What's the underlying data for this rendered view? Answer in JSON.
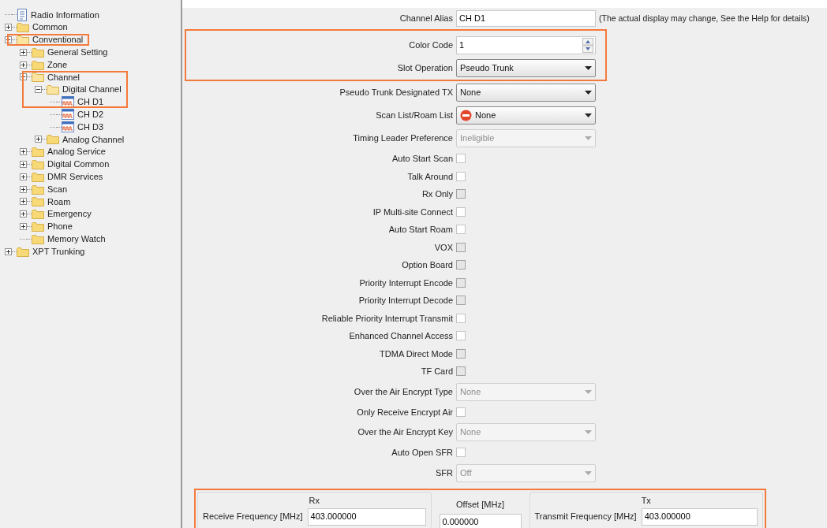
{
  "tree": [
    {
      "label": "Radio Information",
      "kind": "document",
      "highlighted": false
    },
    {
      "label": "Common",
      "kind": "folder",
      "expanded": false,
      "highlighted": false
    },
    {
      "label": "Conventional",
      "kind": "folder",
      "expanded": true,
      "highlighted": true,
      "children": [
        {
          "label": "General Setting",
          "kind": "folder",
          "expanded": false,
          "highlighted": false
        },
        {
          "label": "Zone",
          "kind": "folder",
          "expanded": false,
          "highlighted": false
        },
        {
          "label": "Channel",
          "kind": "folder",
          "expanded": true,
          "highlighted": true,
          "children": [
            {
              "label": "Digital Channel",
              "kind": "folder",
              "expanded": true,
              "highlighted": true,
              "children": [
                {
                  "label": "CH D1",
                  "kind": "channel",
                  "highlighted": true
                },
                {
                  "label": "CH D2",
                  "kind": "channel",
                  "highlighted": false
                },
                {
                  "label": "CH D3",
                  "kind": "channel",
                  "highlighted": false
                }
              ]
            },
            {
              "label": "Analog Channel",
              "kind": "folder",
              "expanded": false,
              "highlighted": false
            }
          ]
        },
        {
          "label": "Analog Service",
          "kind": "folder",
          "expanded": false,
          "highlighted": false
        },
        {
          "label": "Digital Common",
          "kind": "folder",
          "expanded": false,
          "highlighted": false
        },
        {
          "label": "DMR Services",
          "kind": "folder",
          "expanded": false,
          "highlighted": false
        },
        {
          "label": "Scan",
          "kind": "folder",
          "expanded": false,
          "highlighted": false
        },
        {
          "label": "Roam",
          "kind": "folder",
          "expanded": false,
          "highlighted": false
        },
        {
          "label": "Emergency",
          "kind": "folder",
          "expanded": false,
          "highlighted": false
        },
        {
          "label": "Phone",
          "kind": "folder",
          "expanded": false,
          "highlighted": false
        },
        {
          "label": "Memory Watch",
          "kind": "folder",
          "highlighted": false
        }
      ]
    },
    {
      "label": "XPT Trunking",
      "kind": "folder",
      "expanded": false,
      "highlighted": false
    }
  ],
  "form": [
    {
      "highlighted": false,
      "rows": [
        {
          "kind": "text",
          "label": "Channel Alias",
          "value": "CH D1",
          "note": "(The actual display may change, See the Help for details)"
        }
      ]
    },
    {
      "highlighted": true,
      "rows": [
        {
          "kind": "spin",
          "label": "Color Code",
          "value": "1"
        },
        {
          "kind": "select",
          "label": "Slot Operation",
          "value": "Pseudo Trunk",
          "disabled": false,
          "stop_icon": false
        }
      ]
    },
    {
      "highlighted": false,
      "rows": [
        {
          "kind": "select",
          "label": "Pseudo Trunk Designated TX",
          "value": "None",
          "disabled": false,
          "stop_icon": false
        },
        {
          "kind": "select",
          "label": "Scan List/Roam List",
          "value": "None",
          "disabled": false,
          "stop_icon": true
        },
        {
          "kind": "select",
          "label": "Timing Leader Preference",
          "value": "Ineligible",
          "disabled": true,
          "stop_icon": false
        },
        {
          "kind": "checkbox",
          "label": "Auto Start Scan",
          "checked": false,
          "disabled": false
        },
        {
          "kind": "checkbox",
          "label": "Talk Around",
          "checked": false,
          "disabled": false
        },
        {
          "kind": "checkbox",
          "label": "Rx Only",
          "checked": false,
          "disabled": true
        },
        {
          "kind": "checkbox",
          "label": "IP Multi-site Connect",
          "checked": false,
          "disabled": false
        },
        {
          "kind": "checkbox",
          "label": "Auto Start Roam",
          "checked": false,
          "disabled": false
        },
        {
          "kind": "checkbox",
          "label": "VOX",
          "checked": false,
          "disabled": true
        },
        {
          "kind": "checkbox",
          "label": "Option Board",
          "checked": false,
          "disabled": true
        },
        {
          "kind": "checkbox",
          "label": "Priority Interrupt Encode",
          "checked": false,
          "disabled": true
        },
        {
          "kind": "checkbox",
          "label": "Priority Interrupt Decode",
          "checked": false,
          "disabled": true
        },
        {
          "kind": "checkbox",
          "label": "Reliable Priority Interrupt Transmit",
          "checked": false,
          "disabled": false
        },
        {
          "kind": "checkbox",
          "label": "Enhanced Channel Access",
          "checked": false,
          "disabled": false
        },
        {
          "kind": "checkbox",
          "label": "TDMA Direct Mode",
          "checked": false,
          "disabled": true
        },
        {
          "kind": "checkbox",
          "label": "TF Card",
          "checked": false,
          "disabled": true
        },
        {
          "kind": "select",
          "label": "Over the Air Encrypt Type",
          "value": "None",
          "disabled": true,
          "stop_icon": false
        },
        {
          "kind": "checkbox",
          "label": "Only Receive Encrypt Air",
          "checked": false,
          "disabled": false
        },
        {
          "kind": "select",
          "label": "Over the Air Encrypt Key",
          "value": "None",
          "disabled": true,
          "stop_icon": false
        },
        {
          "kind": "checkbox",
          "label": "Auto Open SFR",
          "checked": false,
          "disabled": false
        },
        {
          "kind": "select",
          "label": "SFR",
          "value": "Off",
          "disabled": true,
          "stop_icon": false
        }
      ]
    }
  ],
  "frequency": {
    "highlighted": true,
    "rx": {
      "title": "Rx",
      "label": "Receive Frequency [MHz]",
      "value": "403.000000"
    },
    "offset": {
      "label": "Offset [MHz]",
      "value": "0.000000"
    },
    "tx": {
      "title": "Tx",
      "label": "Transmit Frequency [MHz]",
      "value": "403.000000"
    }
  }
}
